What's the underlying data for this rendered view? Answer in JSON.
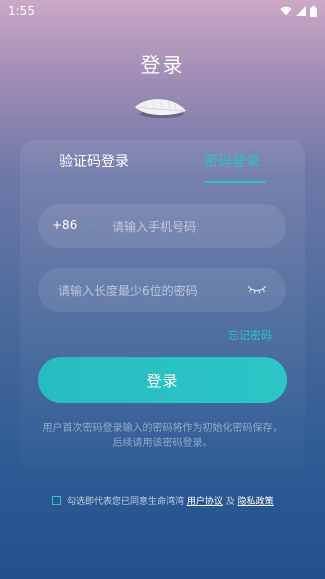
{
  "status": {
    "time": "1:55"
  },
  "page": {
    "title": "登录"
  },
  "tabs": {
    "sms": "验证码登录",
    "password": "密码登录"
  },
  "phone": {
    "country_code": "+86",
    "placeholder": "请输入手机号码"
  },
  "password": {
    "placeholder": "请输入长度最少6位的密码"
  },
  "forgot_label": "忘记密码",
  "login_label": "登录",
  "hint": "用户首次密码登录输入的密码将作为初始化密码保存，后续请用该密码登录。",
  "agreement": {
    "prefix": "勾选即代表您已同意生命湾湾",
    "user_agreement": "用户协议",
    "and": "及",
    "privacy_policy": "隐私政策"
  },
  "colors": {
    "accent": "#2bc3c8",
    "bg_top": "#cba8c6",
    "bg_bottom": "#24508c"
  },
  "icons": [
    "wifi-icon",
    "signal-icon",
    "battery-icon",
    "leaf-logo-icon",
    "chevron-right-icon",
    "eye-closed-icon"
  ]
}
